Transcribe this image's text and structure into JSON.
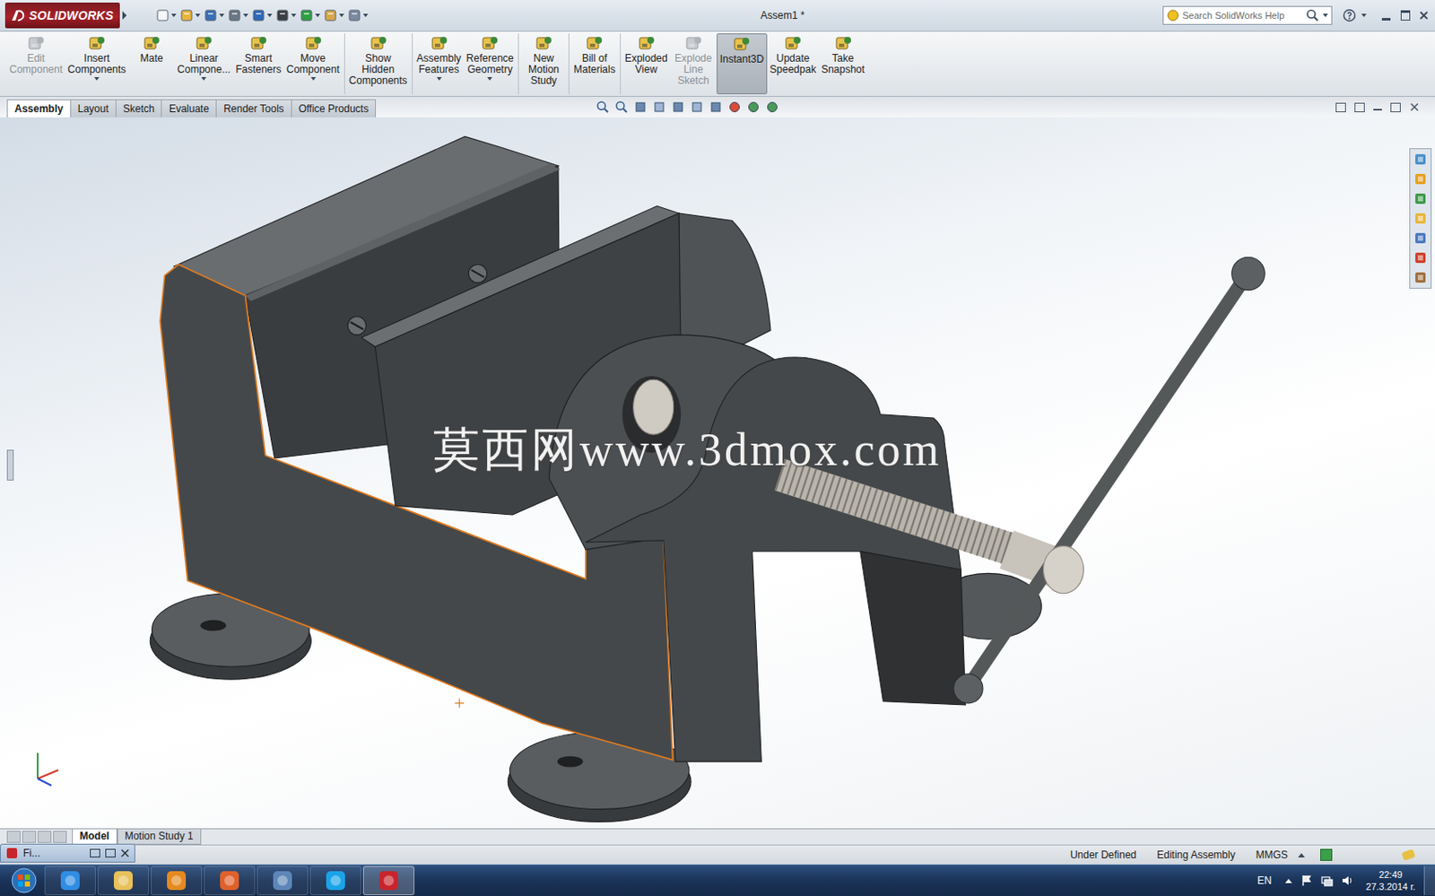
{
  "app": {
    "logo": "SOLIDWORKS",
    "title": "Assem1 *",
    "search_placeholder": "Search SolidWorks Help"
  },
  "ribbon_groups": [
    [
      {
        "lines": [
          "Edit",
          "Component"
        ],
        "dropdown": false,
        "disabled": true,
        "selected": false
      },
      {
        "lines": [
          "Insert",
          "Components"
        ],
        "dropdown": true,
        "disabled": false,
        "selected": false
      },
      {
        "lines": [
          "Mate"
        ],
        "dropdown": false,
        "disabled": false,
        "selected": false
      },
      {
        "lines": [
          "Linear",
          "Compone..."
        ],
        "dropdown": true,
        "disabled": false,
        "selected": false
      },
      {
        "lines": [
          "Smart",
          "Fasteners"
        ],
        "dropdown": false,
        "disabled": false,
        "selected": false
      },
      {
        "lines": [
          "Move",
          "Component"
        ],
        "dropdown": true,
        "disabled": false,
        "selected": false
      }
    ],
    [
      {
        "lines": [
          "Show",
          "Hidden",
          "Components"
        ],
        "dropdown": false,
        "disabled": false,
        "selected": false
      }
    ],
    [
      {
        "lines": [
          "Assembly",
          "Features"
        ],
        "dropdown": true,
        "disabled": false,
        "selected": false
      },
      {
        "lines": [
          "Reference",
          "Geometry"
        ],
        "dropdown": true,
        "disabled": false,
        "selected": false
      }
    ],
    [
      {
        "lines": [
          "New",
          "Motion",
          "Study"
        ],
        "dropdown": false,
        "disabled": false,
        "selected": false
      }
    ],
    [
      {
        "lines": [
          "Bill of",
          "Materials"
        ],
        "dropdown": false,
        "disabled": false,
        "selected": false
      }
    ],
    [
      {
        "lines": [
          "Exploded",
          "View"
        ],
        "dropdown": false,
        "disabled": false,
        "selected": false
      },
      {
        "lines": [
          "Explode",
          "Line",
          "Sketch"
        ],
        "dropdown": false,
        "disabled": true,
        "selected": false
      },
      {
        "lines": [
          "Instant3D"
        ],
        "dropdown": false,
        "disabled": false,
        "selected": true
      },
      {
        "lines": [
          "Update",
          "Speedpak"
        ],
        "dropdown": false,
        "disabled": false,
        "selected": false
      },
      {
        "lines": [
          "Take",
          "Snapshot"
        ],
        "dropdown": false,
        "disabled": false,
        "selected": false
      }
    ]
  ],
  "command_tabs": [
    {
      "label": "Assembly",
      "selected": true
    },
    {
      "label": "Layout",
      "selected": false
    },
    {
      "label": "Sketch",
      "selected": false
    },
    {
      "label": "Evaluate",
      "selected": false
    },
    {
      "label": "Render Tools",
      "selected": false
    },
    {
      "label": "Office Products",
      "selected": false
    }
  ],
  "watermark": "莫西网www.3dmox.com",
  "model_tabs": [
    {
      "label": "Model",
      "selected": true
    },
    {
      "label": "Motion Study 1",
      "selected": false
    }
  ],
  "status_bar": [
    "Under Defined",
    "Editing Assembly",
    "MMGS"
  ],
  "minimized_window": {
    "title": "Fi..."
  },
  "taskbar": {
    "language": "EN",
    "time": "22:49",
    "date": "27.3.2014 г."
  }
}
